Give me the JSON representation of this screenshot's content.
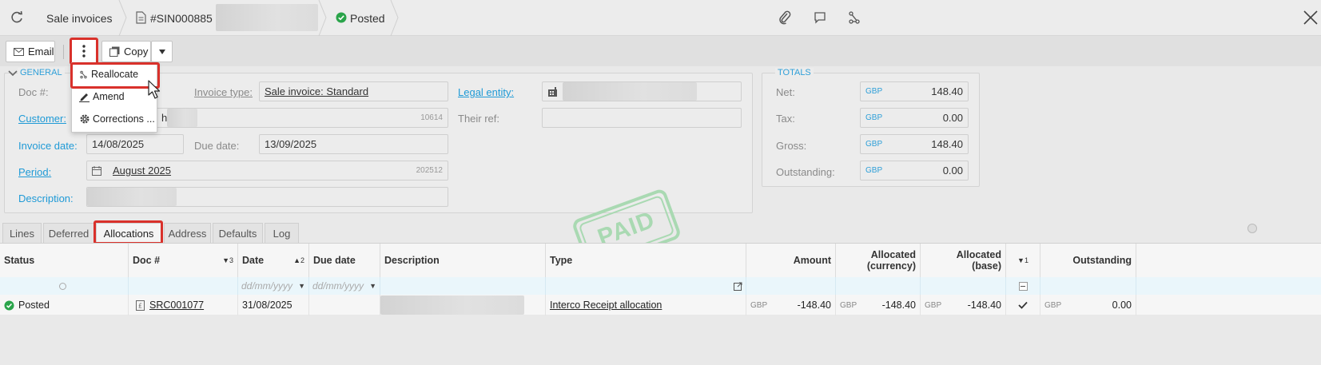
{
  "topbar": {
    "breadcrumb": "Sale invoices",
    "invoice_number": "#SIN000885 -",
    "status": "Posted"
  },
  "toolbar": {
    "email_label": "Email",
    "copy_label": "Copy"
  },
  "more_menu": {
    "items": [
      {
        "label": "Reallocate"
      },
      {
        "label": "Amend"
      },
      {
        "label": "Corrections ..."
      }
    ]
  },
  "general": {
    "legend": "GENERAL",
    "doc_label": "Doc #:",
    "invoice_type_label": "Invoice type:",
    "invoice_type_value": "Sale invoice: Standard",
    "legal_entity_label": "Legal entity:",
    "customer_label": "Customer:",
    "customer_value_partial": "h",
    "customer_code": "10614",
    "their_ref_label": "Their ref:",
    "invoice_date_label": "Invoice date:",
    "invoice_date_value": "14/08/2025",
    "due_date_label": "Due date:",
    "due_date_value": "13/09/2025",
    "period_label": "Period:",
    "period_value": "August 2025",
    "period_code": "202512",
    "description_label": "Description:"
  },
  "totals": {
    "legend": "TOTALS",
    "rows": [
      {
        "label": "Net:",
        "currency": "GBP",
        "value": "148.40"
      },
      {
        "label": "Tax:",
        "currency": "GBP",
        "value": "0.00"
      },
      {
        "label": "Gross:",
        "currency": "GBP",
        "value": "148.40"
      },
      {
        "label": "Outstanding:",
        "currency": "GBP",
        "value": "0.00"
      }
    ]
  },
  "stamp": "PAID",
  "tabs": [
    "Lines",
    "Deferred",
    "Allocations",
    "Address",
    "Defaults",
    "Log"
  ],
  "grid": {
    "headers": {
      "status": "Status",
      "doc": "Doc #",
      "doc_sort": "▼3",
      "date": "Date",
      "date_sort": "▲2",
      "due_date": "Due date",
      "description": "Description",
      "type": "Type",
      "amount": "Amount",
      "alloc_currency_1": "Allocated",
      "alloc_currency_2": "(currency)",
      "alloc_base_1": "Allocated",
      "alloc_base_2": "(base)",
      "check_sort": "▼1",
      "outstanding": "Outstanding"
    },
    "filter": {
      "date_placeholder": "dd/mm/yyyy",
      "due_placeholder": "dd/mm/yyyy"
    },
    "rows": [
      {
        "status": "Posted",
        "doc": "SRC001077",
        "date": "31/08/2025",
        "type": "Interco Receipt allocation",
        "amount_cur": "GBP",
        "amount": "-148.40",
        "alloc_cur_cur": "GBP",
        "alloc_cur": "-148.40",
        "alloc_base_cur": "GBP",
        "alloc_base": "-148.40",
        "out_cur": "GBP",
        "outstanding": "0.00"
      }
    ]
  },
  "colors": {
    "accent": "#1f9ad6",
    "highlight": "#d9312b",
    "posted_green": "#2aa44a",
    "stamp_green": "#9fd3a8"
  }
}
